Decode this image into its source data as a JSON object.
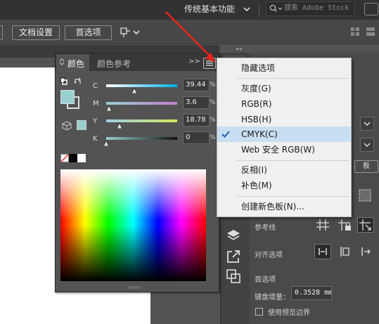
{
  "topbar": {
    "workspace_label": "传统基本功能",
    "search_placeholder": "搜索 Adobe Stock"
  },
  "control_bar": {
    "document_setup_label": "文档设置",
    "preferences_label": "首选项"
  },
  "color_panel": {
    "tabs": [
      {
        "label": "颜色",
        "active": true
      },
      {
        "label": "颜色参考",
        "active": false
      }
    ],
    "collapse_label": ">>",
    "fill_color": "#98d0d0",
    "sliders": [
      {
        "label": "C",
        "value": "39.44",
        "unit": "%",
        "level": 0.3944
      },
      {
        "label": "M",
        "value": "3.6",
        "unit": "%",
        "level": 0.036
      },
      {
        "label": "Y",
        "value": "18.78",
        "unit": "%",
        "level": 0.1878
      },
      {
        "label": "K",
        "value": "0",
        "unit": "%",
        "level": 0
      }
    ]
  },
  "flyout_menu": {
    "items": [
      {
        "label": "隐藏选项",
        "checked": false
      },
      {
        "label": "灰度(G)",
        "checked": false
      },
      {
        "label": "RGB(R)",
        "checked": false
      },
      {
        "label": "HSB(H)",
        "checked": false
      },
      {
        "label": "CMYK(C)",
        "checked": true
      },
      {
        "label": "Web 安全 RGB(W)",
        "checked": false
      },
      {
        "label": "反相(I)",
        "checked": false
      },
      {
        "label": "补色(M)",
        "checked": false
      },
      {
        "label": "创建新色板(N)...",
        "checked": false
      }
    ]
  },
  "dock": {
    "collapse_label": "««"
  },
  "properties": {
    "guides_label": "参考线",
    "align_label": "对齐选项",
    "prefs_heading": "首选项",
    "keyboard_increment_label": "键盘增量：",
    "keyboard_increment_value": "0.3528 mm",
    "preview_bounds_label": "使用预览边界",
    "partial_button_label": "板"
  },
  "colors": {
    "accent_arrow": "#e8241c",
    "menu_selected": "#c8def2"
  }
}
